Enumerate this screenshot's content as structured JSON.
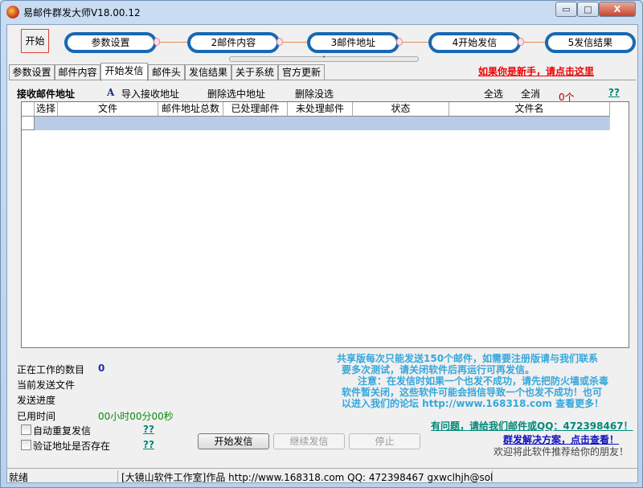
{
  "window": {
    "title": "易邮件群发大师V18.00.12",
    "minimize": "▭",
    "maximize": "□",
    "close": "X"
  },
  "flow": {
    "start": "开始",
    "steps": [
      "参数设置",
      "2邮件内容",
      "3邮件地址",
      "4开始发信",
      "5发信结果"
    ],
    "splitter": "˅"
  },
  "tabs": [
    {
      "label": "参数设置"
    },
    {
      "label": "邮件内容"
    },
    {
      "label": "开始发信",
      "active": true
    },
    {
      "label": "邮件头"
    },
    {
      "label": "发信结果"
    },
    {
      "label": "关于系统"
    },
    {
      "label": "官方更新"
    }
  ],
  "newbie_link": "如果你是新手，请点击这里",
  "toolbar": {
    "title": "接收邮件地址",
    "import": "导入接收地址",
    "delete_selected": "删除选中地址",
    "delete_unselected": "删除没选",
    "select_all": "全选",
    "select_none": "全消",
    "count": "0个",
    "help": "??"
  },
  "grid": {
    "columns": [
      "选择",
      "文件",
      "邮件地址总数",
      "已处理邮件",
      "未处理邮件",
      "状态",
      "文件名"
    ]
  },
  "stats": {
    "working_label": "正在工作的数目",
    "working_value": "0",
    "current_file_label": "当前发送文件",
    "progress_label": "发送进度",
    "elapsed_label": "已用时间",
    "elapsed_value": "00小时00分00秒"
  },
  "options": {
    "auto_repeat": "自动重复发信",
    "verify": "验证地址是否存在",
    "help": "??"
  },
  "buttons": {
    "start": "开始发信",
    "resume": "继续发信",
    "stop": "停止"
  },
  "notice": [
    "共享版每次只能发送150个邮件，如需要注册版请与我们联系",
    "要多次测试，请关闭软件后再运行可再发信。",
    "注意：在发信时如果一个也发不成功，请先把防火墙或杀毒",
    "软件暂关闭，这些软件可能会挡信导致一个也发不成功！也可",
    "以进入我们的论坛 http://www.168318.com 查看更多！"
  ],
  "links": {
    "contact": "有问题，请给我们邮件或QQ：472398467！",
    "solution": "群发解决方案，点击查看！",
    "recommend": "欢迎将此软件推荐给你的朋友！"
  },
  "statusbar": {
    "state": "就绪",
    "info": "[大镜山软件工作室]作品 http://www.168318.com QQ: 472398467 gxwclhjh@sohu.c"
  },
  "colors": {
    "accent": "#1769b3",
    "red": "#e00000",
    "notice": "#35a7dc",
    "green": "#0a8a0a"
  }
}
